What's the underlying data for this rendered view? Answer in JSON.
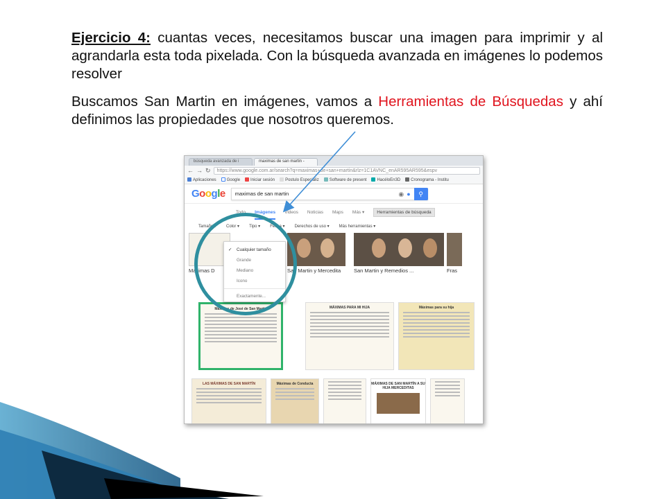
{
  "slide": {
    "p1_label": "Ejercicio 4:",
    "p1_text": " cuantas veces, necesitamos buscar una imagen para imprimir y al agrandarla esta toda pixelada. Con la búsqueda avanzada en imágenes lo podemos resolver",
    "p2_start": "Buscamos San Martin en imágenes, vamos a ",
    "p2_red": "Herramientas de Búsquedas",
    "p2_end": " y ahí definimos las propiedades que nosotros queremos."
  },
  "colors": {
    "accent_red": "#e0141e",
    "ring": "#2f8f9f",
    "arrow": "#3f8ed6",
    "google_blue": "#4285f4"
  },
  "browser": {
    "tabs": [
      "búsqueda avanzada de i",
      "maximas de san martin -"
    ],
    "address": "https://www.google.com.ar/search?q=maximas+de+san+martin&rlz=1C1AVNC_enAR595AR595&espv",
    "nav_icons": [
      "back-icon",
      "forward-icon",
      "reload-icon"
    ],
    "bookmarks": [
      "Aplicaciones",
      "Google",
      "Iniciar sesión",
      "Postulo Especializ",
      "Software de present",
      "HacéloEn3D",
      "Cronograma - Institu"
    ]
  },
  "google": {
    "logo": "Google",
    "query": "maximas de san martin",
    "tabs": [
      "Todo",
      "Imágenes",
      "Videos",
      "Noticias",
      "Maps",
      "Más ▾"
    ],
    "tools_button": "Herramientas de búsqueda",
    "filters": [
      "Tamaño ▾",
      "Color ▾",
      "Tipo ▾",
      "Fecha ▾",
      "Derechos de uso ▾",
      "Más herramientas ▾"
    ],
    "size_menu": [
      "Cualquier tamaño",
      "Grande",
      "Mediano",
      "Icono",
      "Exactamente..."
    ],
    "selected_size": "Cualquier tamaño",
    "captions": [
      "Maximas D",
      "San Martin y Mercedita",
      "San Martin y Remedios ...",
      "Fras"
    ],
    "doc_titles": [
      "Máximas de José de San Martín",
      "MÁXIMAS PARA MI HIJA",
      "Máximas para su hija",
      "LAS MÁXIMAS DE SAN MARTÍN",
      "Máximas de Conducta",
      "MÁXIMAS DE SAN MARTÍN A SU HIJA MERCEDITAS"
    ]
  }
}
